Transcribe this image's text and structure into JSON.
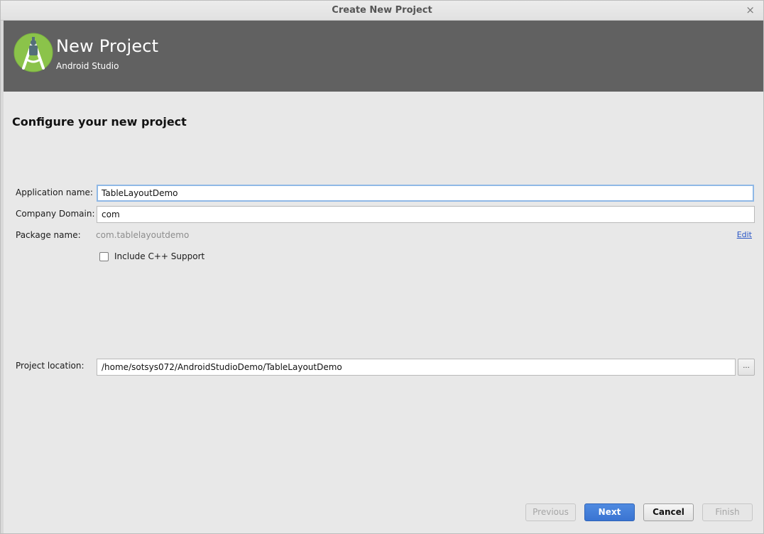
{
  "window": {
    "title": "Create New Project",
    "close_glyph": "×"
  },
  "header": {
    "title": "New Project",
    "subtitle": "Android Studio",
    "logo_icon": "android-studio-logo"
  },
  "main": {
    "section_title": "Configure your new project",
    "fields": {
      "app_name_label": "Application name:",
      "app_name_value": "TableLayoutDemo",
      "company_domain_label": "Company Domain:",
      "company_domain_value": "com",
      "package_name_label": "Package name:",
      "package_name_value": "com.tablelayoutdemo",
      "edit_link": "Edit",
      "cpp_support_label": "Include C++ Support",
      "cpp_support_checked": false,
      "project_location_label": "Project location:",
      "project_location_value": "/home/sotsys072/AndroidStudioDemo/TableLayoutDemo",
      "browse_label": "..."
    }
  },
  "footer": {
    "previous_label": "Previous",
    "next_label": "Next",
    "cancel_label": "Cancel",
    "finish_label": "Finish"
  },
  "colors": {
    "header_bg": "#616161",
    "body_bg": "#e8e8e8",
    "primary_button": "#3a74d2",
    "link": "#2a56c6",
    "logo_green": "#8bc34a"
  }
}
